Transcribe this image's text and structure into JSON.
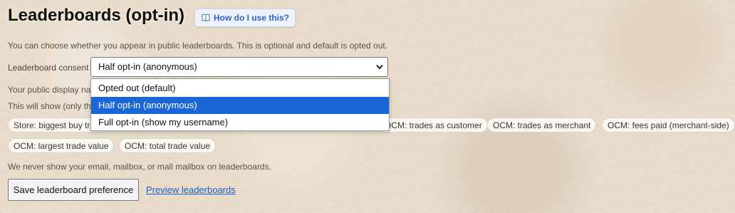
{
  "header": {
    "title": "Leaderboards (opt-in)",
    "help_label": "How do I use this?"
  },
  "intro_text": "You can choose whether you appear in public leaderboards. This is optional and default is opted out.",
  "consent": {
    "label": "Leaderboard consent",
    "selected": "Half opt-in (anonymous)",
    "options": [
      {
        "label": "Opted out (default)",
        "selected": false
      },
      {
        "label": "Half opt-in (anonymous)",
        "selected": true
      },
      {
        "label": "Full opt-in (show my username)",
        "selected": false
      }
    ]
  },
  "display_name_text": "Your public display na",
  "show_text": "This will show (only th",
  "stat_pills": [
    "Store: biggest buy tra",
    "OCM: trades as customer",
    "OCM: trades as merchant",
    "OCM: fees paid (merchant-side)",
    "OCM: largest trade value",
    "OCM: total trade value"
  ],
  "privacy_note": "We never show your email, mailbox, or mall mailbox on leaderboards.",
  "actions": {
    "save_label": "Save leaderboard preference",
    "preview_label": "Preview leaderboards"
  },
  "colors": {
    "background": "#e9dccb",
    "accent": "#1a66d4",
    "link": "#1a5fc8"
  },
  "icons": {
    "help": "book-icon",
    "select": "chevron-down-icon"
  }
}
